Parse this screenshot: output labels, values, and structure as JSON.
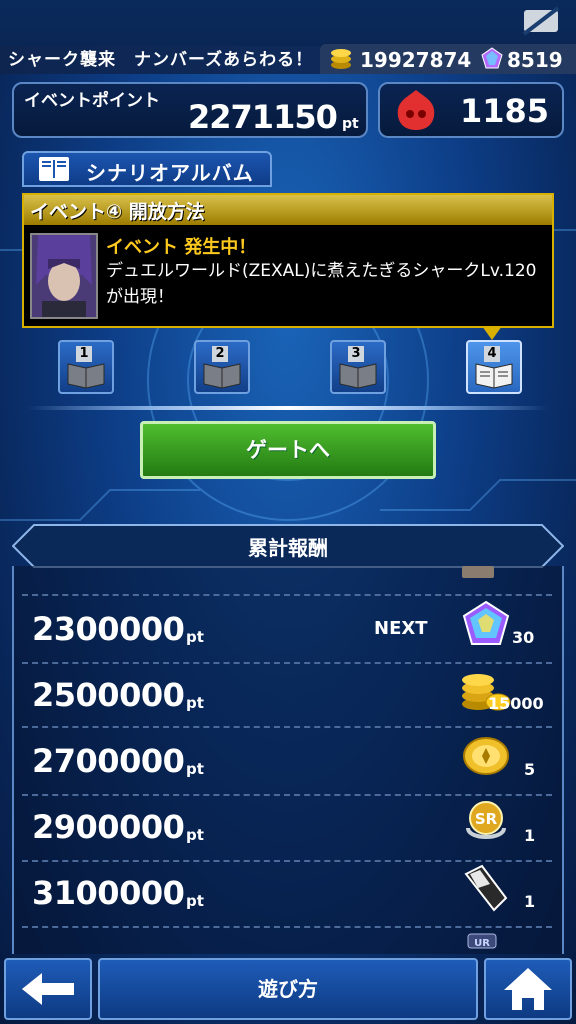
{
  "header": {
    "title": "シャーク襲来　ナンバーズあらわる！",
    "coins": "19927874",
    "gems": "8519"
  },
  "event_points": {
    "label": "イベントポイント",
    "value": "2271150",
    "unit": "pt"
  },
  "stamina": {
    "value": "1185"
  },
  "album": {
    "label": "シナリオアルバム"
  },
  "event_panel": {
    "heading": "イベント④ 開放方法",
    "status": "イベント 発生中！",
    "description": "デュエルワールド(ZEXAL)に煮えたぎるシャークLv.120が出現！"
  },
  "chapters": [
    {
      "number": "1"
    },
    {
      "number": "2"
    },
    {
      "number": "3"
    },
    {
      "number": "4"
    }
  ],
  "gate_button": {
    "label": "ゲートへ"
  },
  "rewards": {
    "title": "累計報酬",
    "next_label": "NEXT",
    "unit": "pt",
    "rows": [
      {
        "points": "2300000",
        "icon": "prism-gem-icon",
        "qty": "30"
      },
      {
        "points": "2500000",
        "icon": "gold-coins-icon",
        "qty": "15000"
      },
      {
        "points": "2700000",
        "icon": "gold-medal-icon",
        "qty": "5"
      },
      {
        "points": "2900000",
        "icon": "sr-ticket-icon",
        "qty": "1"
      },
      {
        "points": "3100000",
        "icon": "crystal-shard-icon",
        "qty": "1"
      }
    ]
  },
  "footer": {
    "help_label": "遊び方"
  },
  "colors": {
    "accent_gold": "#d8b000",
    "status_yellow": "#ffc91e",
    "gate_green": "#3aa322",
    "panel_border": "#5b87c5"
  }
}
